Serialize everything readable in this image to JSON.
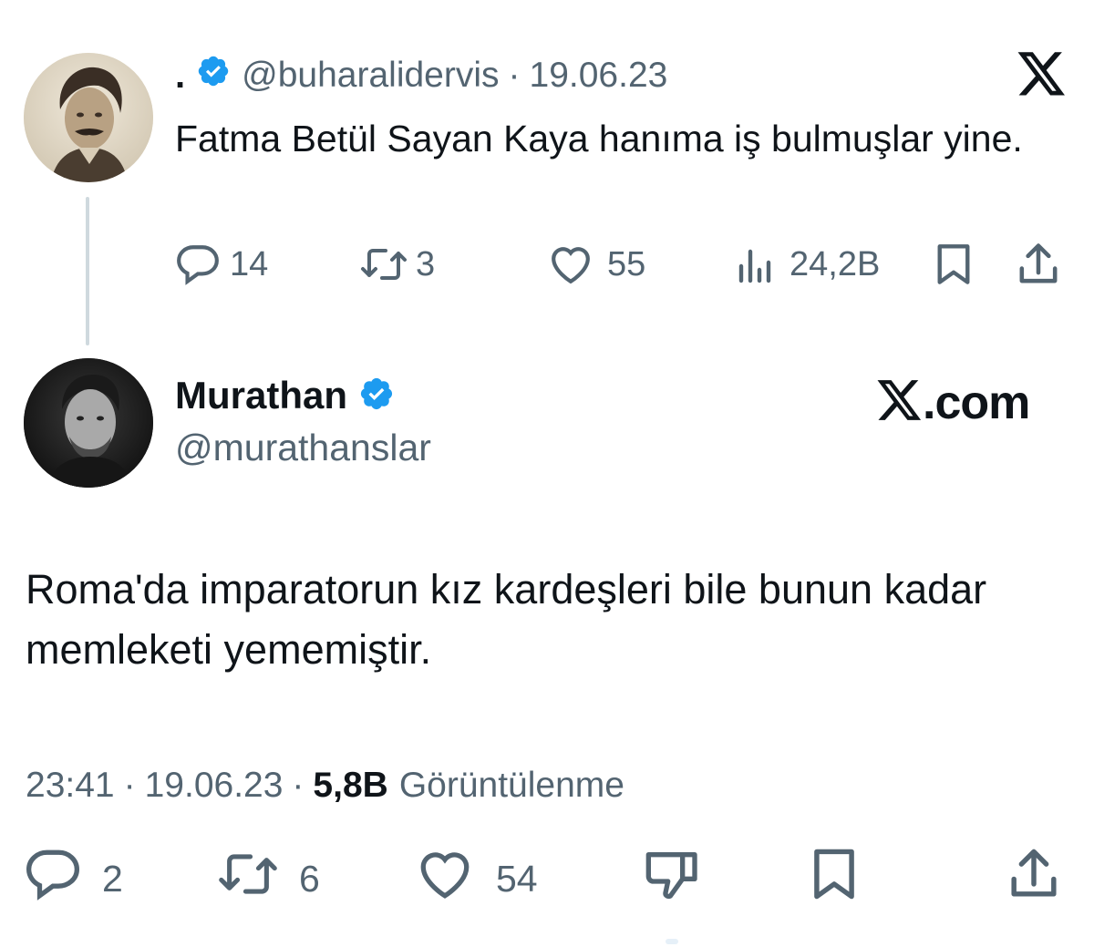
{
  "parent_tweet": {
    "display_name": ".",
    "handle": "@buharalidervis",
    "separator": "·",
    "date": "19.06.23",
    "text": "Fatma Betül Sayan Kaya hanıma iş bulmuşlar yine.",
    "metrics": {
      "replies": "14",
      "retweets": "3",
      "likes": "55",
      "views": "24,2B"
    }
  },
  "main_tweet": {
    "display_name": "Murathan",
    "handle": "@murathanslar",
    "brand": ".com",
    "text": "Roma'da imparatorun kız kardeşleri bile bunun kadar memleketi yememiştir.",
    "time": "23:41",
    "date": "19.06.23",
    "separator": "·",
    "views_count": "5,8B",
    "views_label": "Görüntülenme",
    "metrics": {
      "replies": "2",
      "retweets": "6",
      "likes": "54"
    }
  },
  "colors": {
    "verified": "#1d9bf0",
    "secondary_text": "#536471",
    "primary_text": "#0f1419",
    "thread_line": "#cfd9de"
  },
  "icons": [
    "verified-badge-icon",
    "x-logo-icon",
    "reply-icon",
    "retweet-icon",
    "like-icon",
    "views-icon",
    "bookmark-icon",
    "share-icon",
    "dislike-icon"
  ]
}
